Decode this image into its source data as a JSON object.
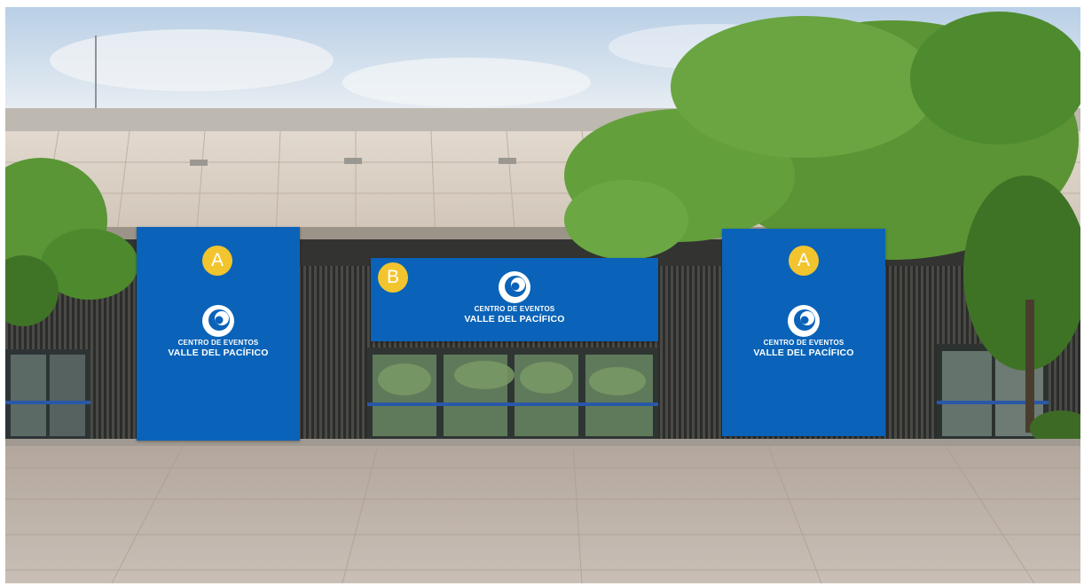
{
  "signage": {
    "left": {
      "badge": "A",
      "logo_line1": "CENTRO DE EVENTOS",
      "logo_line2": "VALLE DEL PACÍFICO"
    },
    "center": {
      "badge": "B",
      "logo_line1": "CENTRO DE EVENTOS",
      "logo_line2": "VALLE DEL PACÍFICO"
    },
    "right": {
      "badge": "A",
      "logo_line1": "CENTRO DE EVENTOS",
      "logo_line2": "VALLE DEL PACÍFICO"
    }
  },
  "colors": {
    "banner": "#0a63b8",
    "badge": "#f2c42e",
    "logo": "#ffffff"
  }
}
